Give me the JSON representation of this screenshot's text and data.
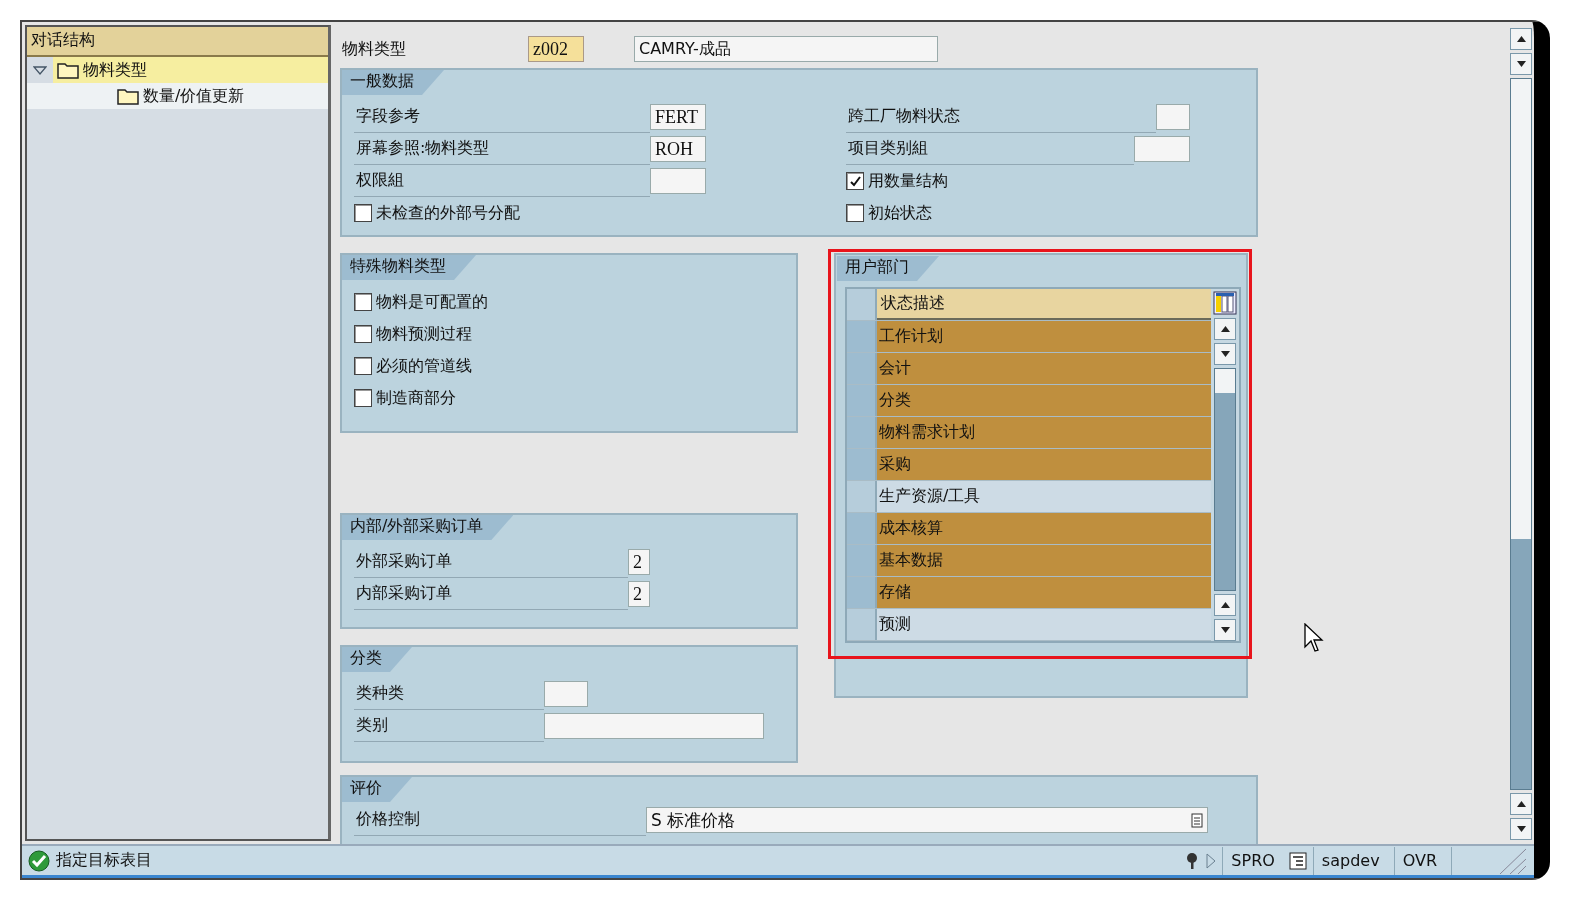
{
  "tree": {
    "title": "对话结构",
    "items": [
      {
        "label": "物料类型",
        "expanded": true,
        "selected": true,
        "children": [
          {
            "label": "数量/价值更新",
            "selected": false
          }
        ]
      }
    ]
  },
  "header": {
    "label": "物料类型",
    "value": "z002",
    "description": "CAMRY-成品"
  },
  "general": {
    "title": "一般数据",
    "left": [
      {
        "kind": "field",
        "label": "字段参考",
        "value": "FERT"
      },
      {
        "kind": "field",
        "label": "屏幕参照:物料类型",
        "value": "ROH"
      },
      {
        "kind": "field",
        "label": "权限組"
      },
      {
        "kind": "checkbox",
        "label": "未检查的外部号分配",
        "checked": false
      }
    ],
    "right": [
      {
        "kind": "field",
        "label": "跨工厂物料状态"
      },
      {
        "kind": "field",
        "label": "项目类别組"
      },
      {
        "kind": "checkbox",
        "label": "用数量结构",
        "checked": true
      },
      {
        "kind": "checkbox",
        "label": "初始状态",
        "checked": false
      }
    ]
  },
  "special": {
    "title": "特殊物料类型",
    "items": [
      {
        "label": "物料是可配置的",
        "checked": false
      },
      {
        "label": "物料预测过程",
        "checked": false
      },
      {
        "label": "必须的管道线",
        "checked": false
      },
      {
        "label": "制造商部分",
        "checked": false
      }
    ]
  },
  "orders": {
    "title": "内部/外部采购订单",
    "fields": [
      {
        "label": "外部采购订单",
        "value": "2"
      },
      {
        "label": "内部采购订单",
        "value": "2"
      }
    ]
  },
  "classification": {
    "title": "分类",
    "fields": [
      {
        "label": "类种类"
      },
      {
        "label": "类别"
      }
    ]
  },
  "user_departments": {
    "title": "用户部门",
    "column": "状态描述",
    "rows": [
      {
        "label": "工作计划",
        "selected": true
      },
      {
        "label": "会计",
        "selected": true
      },
      {
        "label": "分类",
        "selected": true
      },
      {
        "label": "物料需求计划",
        "selected": true
      },
      {
        "label": "采购",
        "selected": true
      },
      {
        "label": "生产资源/工具",
        "selected": false
      },
      {
        "label": "成本核算",
        "selected": true
      },
      {
        "label": "基本数据",
        "selected": true
      },
      {
        "label": "存储",
        "selected": true
      },
      {
        "label": "预测",
        "selected": false
      }
    ]
  },
  "valuation": {
    "title": "评价",
    "fields": [
      {
        "label": "价格控制",
        "value": "S 标准价格"
      }
    ]
  },
  "status_bar": {
    "message": "指定目标表目",
    "transaction": "SPRO",
    "system": "sapdev",
    "mode": "OVR"
  }
}
